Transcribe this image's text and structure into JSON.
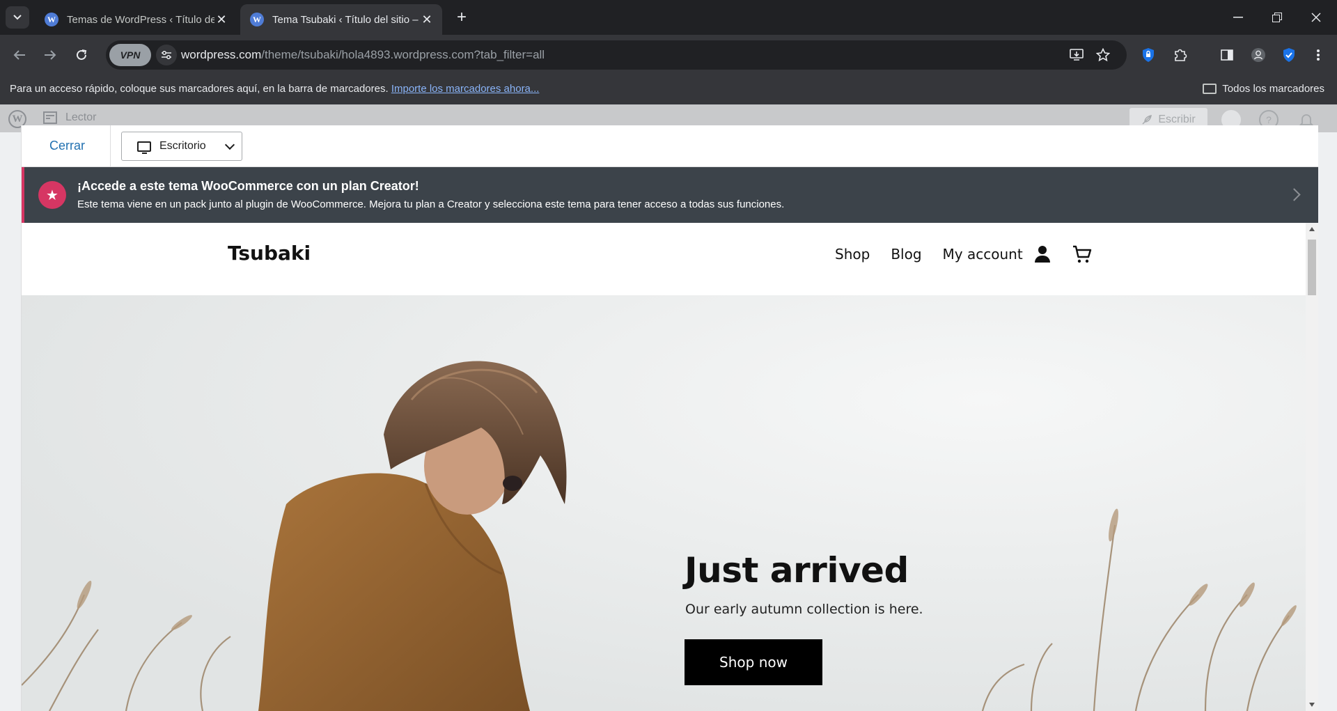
{
  "browser": {
    "tabs": [
      {
        "title": "Temas de WordPress ‹ Título de",
        "favicon": "wordpress-icon"
      },
      {
        "title": "Tema Tsubaki ‹ Título del sitio –",
        "favicon": "wordpress-icon"
      }
    ],
    "url_host": "wordpress.com",
    "url_path": "/theme/tsubaki/hola4893.wordpress.com?tab_filter=all",
    "vpn_label": "VPN",
    "bookmarks_prompt": "Para un acceso rápido, coloque sus marcadores aquí, en la barra de marcadores.",
    "bookmarks_link": "Importe los marcadores ahora...",
    "all_bookmarks": "Todos los marcadores"
  },
  "wp_admin": {
    "reader_label": "Lector",
    "write_label": "Escribir"
  },
  "preview": {
    "close_label": "Cerrar",
    "device_selected": "Escritorio",
    "banner_title": "¡Accede a este tema WooCommerce con un plan Creator!",
    "banner_desc": "Este tema viene en un pack junto al plugin de WooCommerce. Mejora tu plan a Creator y selecciona este tema para tener acceso a todas sus funciones."
  },
  "theme_site": {
    "title": "Tsubaki",
    "nav": [
      "Shop",
      "Blog",
      "My account"
    ],
    "hero_title": "Just arrived",
    "hero_subtitle": "Our early autumn collection is here.",
    "hero_button": "Shop now"
  },
  "colors": {
    "accent_pink": "#d63663",
    "banner_bg": "#3c434a",
    "link_blue": "#2271b1"
  }
}
